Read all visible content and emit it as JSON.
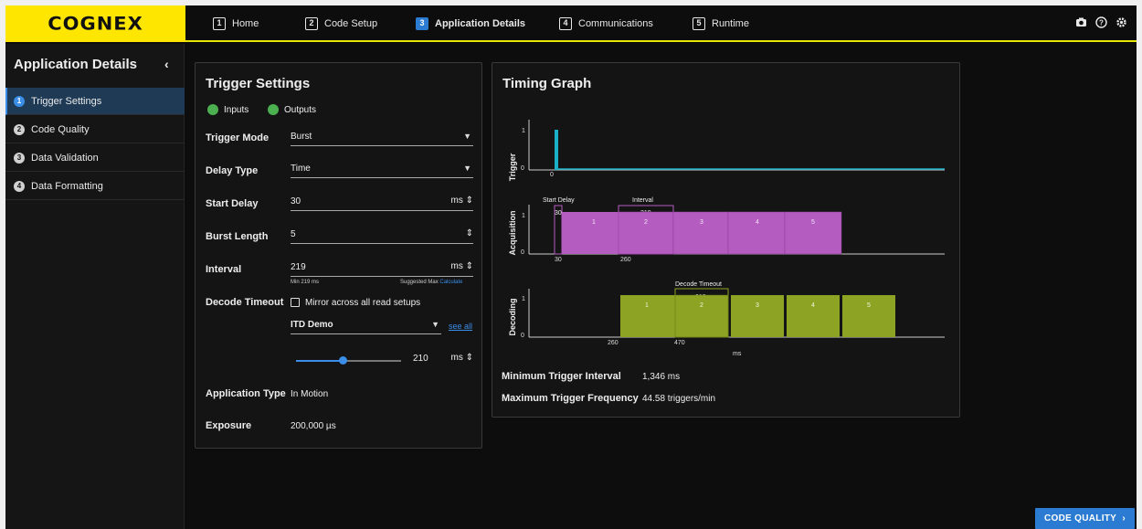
{
  "brand": "COGNEX",
  "nav": [
    {
      "num": "1",
      "label": "Home"
    },
    {
      "num": "2",
      "label": "Code Setup"
    },
    {
      "num": "3",
      "label": "Application Details"
    },
    {
      "num": "4",
      "label": "Communications"
    },
    {
      "num": "5",
      "label": "Runtime"
    }
  ],
  "top_icons": [
    "camera-icon",
    "help-icon",
    "settings-icon"
  ],
  "sidebar": {
    "title": "Application Details",
    "collapse": "‹",
    "items": [
      {
        "num": "1",
        "label": "Trigger Settings"
      },
      {
        "num": "2",
        "label": "Code Quality"
      },
      {
        "num": "3",
        "label": "Data Validation"
      },
      {
        "num": "4",
        "label": "Data Formatting"
      }
    ]
  },
  "trigger": {
    "title": "Trigger Settings",
    "legend_inputs": "Inputs",
    "legend_outputs": "Outputs",
    "mode_label": "Trigger Mode",
    "mode_value": "Burst",
    "delay_type_label": "Delay Type",
    "delay_type_value": "Time",
    "start_delay_label": "Start Delay",
    "start_delay_value": "30",
    "start_delay_unit": "ms",
    "burst_length_label": "Burst Length",
    "burst_length_value": "5",
    "interval_label": "Interval",
    "interval_value": "219",
    "interval_unit": "ms",
    "interval_min": "Min 219 ms",
    "interval_suggested": "Suggested Max",
    "interval_calculate": "Calculate",
    "decode_timeout_label": "Decode Timeout",
    "mirror_label": "Mirror across all read setups",
    "read_setup_value": "ITD Demo",
    "see_all": "see all",
    "timeout_value": "210",
    "timeout_unit": "ms",
    "app_type_label": "Application Type",
    "app_type_value": "In Motion",
    "exposure_label": "Exposure",
    "exposure_value": "200,000 µs"
  },
  "timing": {
    "title": "Timing Graph",
    "rows": {
      "trigger": "Trigger",
      "acquisition": "Acquisition",
      "decoding": "Decoding"
    },
    "axis_one": "1",
    "axis_zero": "0",
    "trigger_zero": "0",
    "start_delay_label": "Start Delay",
    "start_delay_value": "30",
    "interval_label": "Interval",
    "interval_value": "219",
    "acq_tick_a": "30",
    "acq_tick_b": "260",
    "acq_blocks": [
      "1",
      "2",
      "3",
      "4",
      "5"
    ],
    "decode_timeout_label": "Decode Timeout",
    "decode_timeout_value": "210",
    "dec_tick_a": "260",
    "dec_tick_b": "470",
    "dec_blocks": [
      "1",
      "2",
      "3",
      "4",
      "5"
    ],
    "x_unit": "ms",
    "trigger_color": "#1ab0c8",
    "acq_color": "#b45cc0",
    "dec_color": "#8ca324",
    "min_interval_label": "Minimum Trigger Interval",
    "min_interval_value": "1,346 ms",
    "max_freq_label": "Maximum Trigger Frequency",
    "max_freq_value": "44.58 triggers/min"
  },
  "next_button": "CODE QUALITY"
}
